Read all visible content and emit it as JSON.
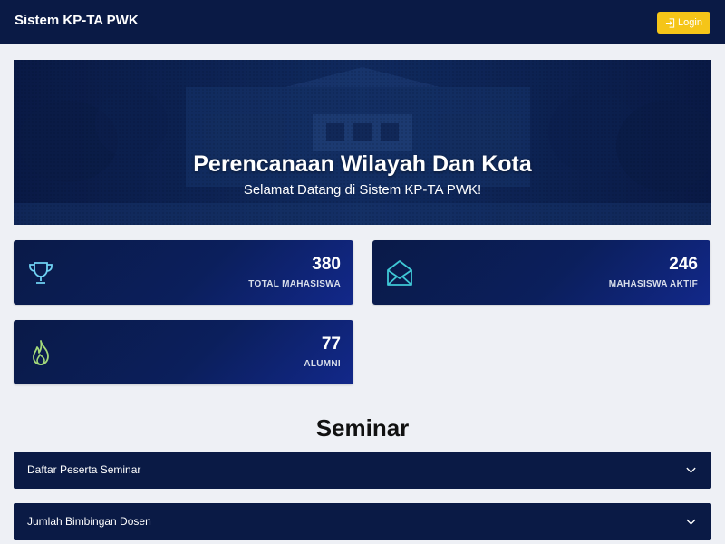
{
  "navbar": {
    "brand": "Sistem KP-TA PWK",
    "login_label": "Login",
    "login_icon": "login-icon",
    "accent_color": "#f5c518"
  },
  "hero": {
    "title": "Perencanaan Wilayah Dan Kota",
    "subtitle": "Selamat Datang di Sistem KP-TA PWK!"
  },
  "stats": [
    {
      "value": "380",
      "label": "TOTAL MAHASISWA",
      "icon": "trophy-icon",
      "icon_color": "#6fd1f2"
    },
    {
      "value": "246",
      "label": "MAHASISWA AKTIF",
      "icon": "envelope-open-icon",
      "icon_color": "#3fc8d6"
    },
    {
      "value": "77",
      "label": "ALUMNI",
      "icon": "fire-icon",
      "icon_color": "#a3d97a"
    }
  ],
  "seminar": {
    "title": "Seminar",
    "sections": [
      {
        "label": "Daftar Peserta Seminar",
        "icon": "chevron-down-icon"
      },
      {
        "label": "Jumlah Bimbingan Dosen",
        "icon": "chevron-down-icon"
      }
    ]
  }
}
